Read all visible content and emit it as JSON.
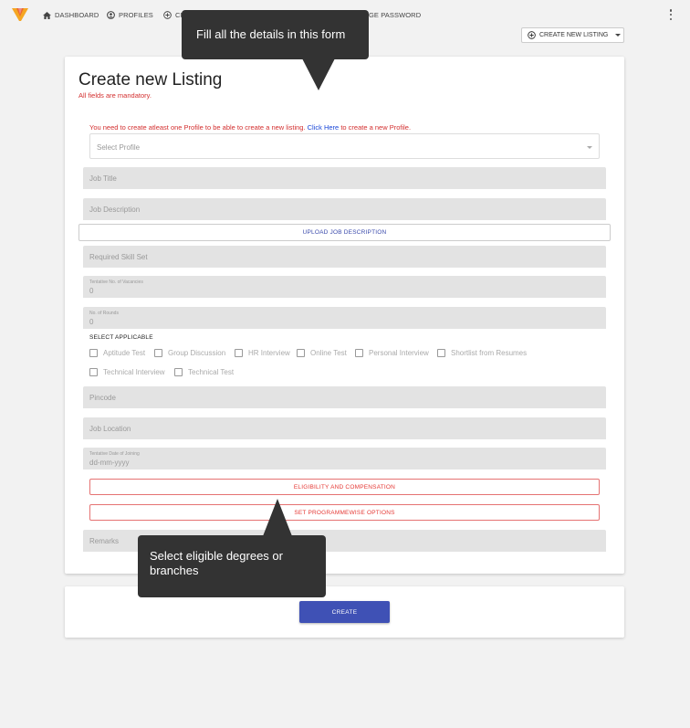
{
  "nav": {
    "items": [
      {
        "label": "DASHBOARD",
        "icon": "home-icon"
      },
      {
        "label": "PROFILES",
        "icon": "profile-icon"
      },
      {
        "label": "CR",
        "icon": "add-circle-icon"
      },
      {
        "label": "GE PASSWORD"
      }
    ]
  },
  "header": {
    "create_new_listing": "CREATE NEW LISTING"
  },
  "form": {
    "title": "Create new Listing",
    "mandatory_note": "All fields are mandatory.",
    "profile_warning_prefix": "You need to create atleast one Profile to be able to create a new listing.",
    "profile_warning_link": "Click Here",
    "profile_warning_suffix": "to create a new Profile.",
    "select_profile_placeholder": "Select Profile",
    "job_title": "Job Title",
    "job_description": "Job Description",
    "upload_job_description": "UPLOAD JOB DESCRIPTION",
    "required_skill_set": "Required Skill Set",
    "vacancies_label": "Tentative No. of Vacancies",
    "vacancies_value": "0",
    "rounds_label": "No. of Rounds",
    "rounds_value": "0",
    "select_applicable": "SELECT APPLICABLE",
    "checkboxes": [
      "Aptitude Test",
      "Group Discussion",
      "HR Interview",
      "Online Test",
      "Personal Interview",
      "Shortlist from Resumes",
      "Technical Interview",
      "Technical Test"
    ],
    "pincode": "Pincode",
    "job_location": "Job Location",
    "joining_label": "Tentative Date of Joining",
    "joining_placeholder": "dd-mm-yyyy",
    "eligibility_button": "ELIGIBILITY AND COMPENSATION",
    "programmewise_button": "SET PROGRAMMEWISE OPTIONS",
    "remarks": "Remarks",
    "create_button": "CREATE"
  },
  "tooltips": {
    "top": "Fill all the details in this form",
    "bottom": "Select eligible degrees or branches"
  },
  "colors": {
    "accent": "#3f51b5",
    "error": "#d32f2f",
    "link": "#1a47d8",
    "tooltip_bg": "#333333"
  }
}
